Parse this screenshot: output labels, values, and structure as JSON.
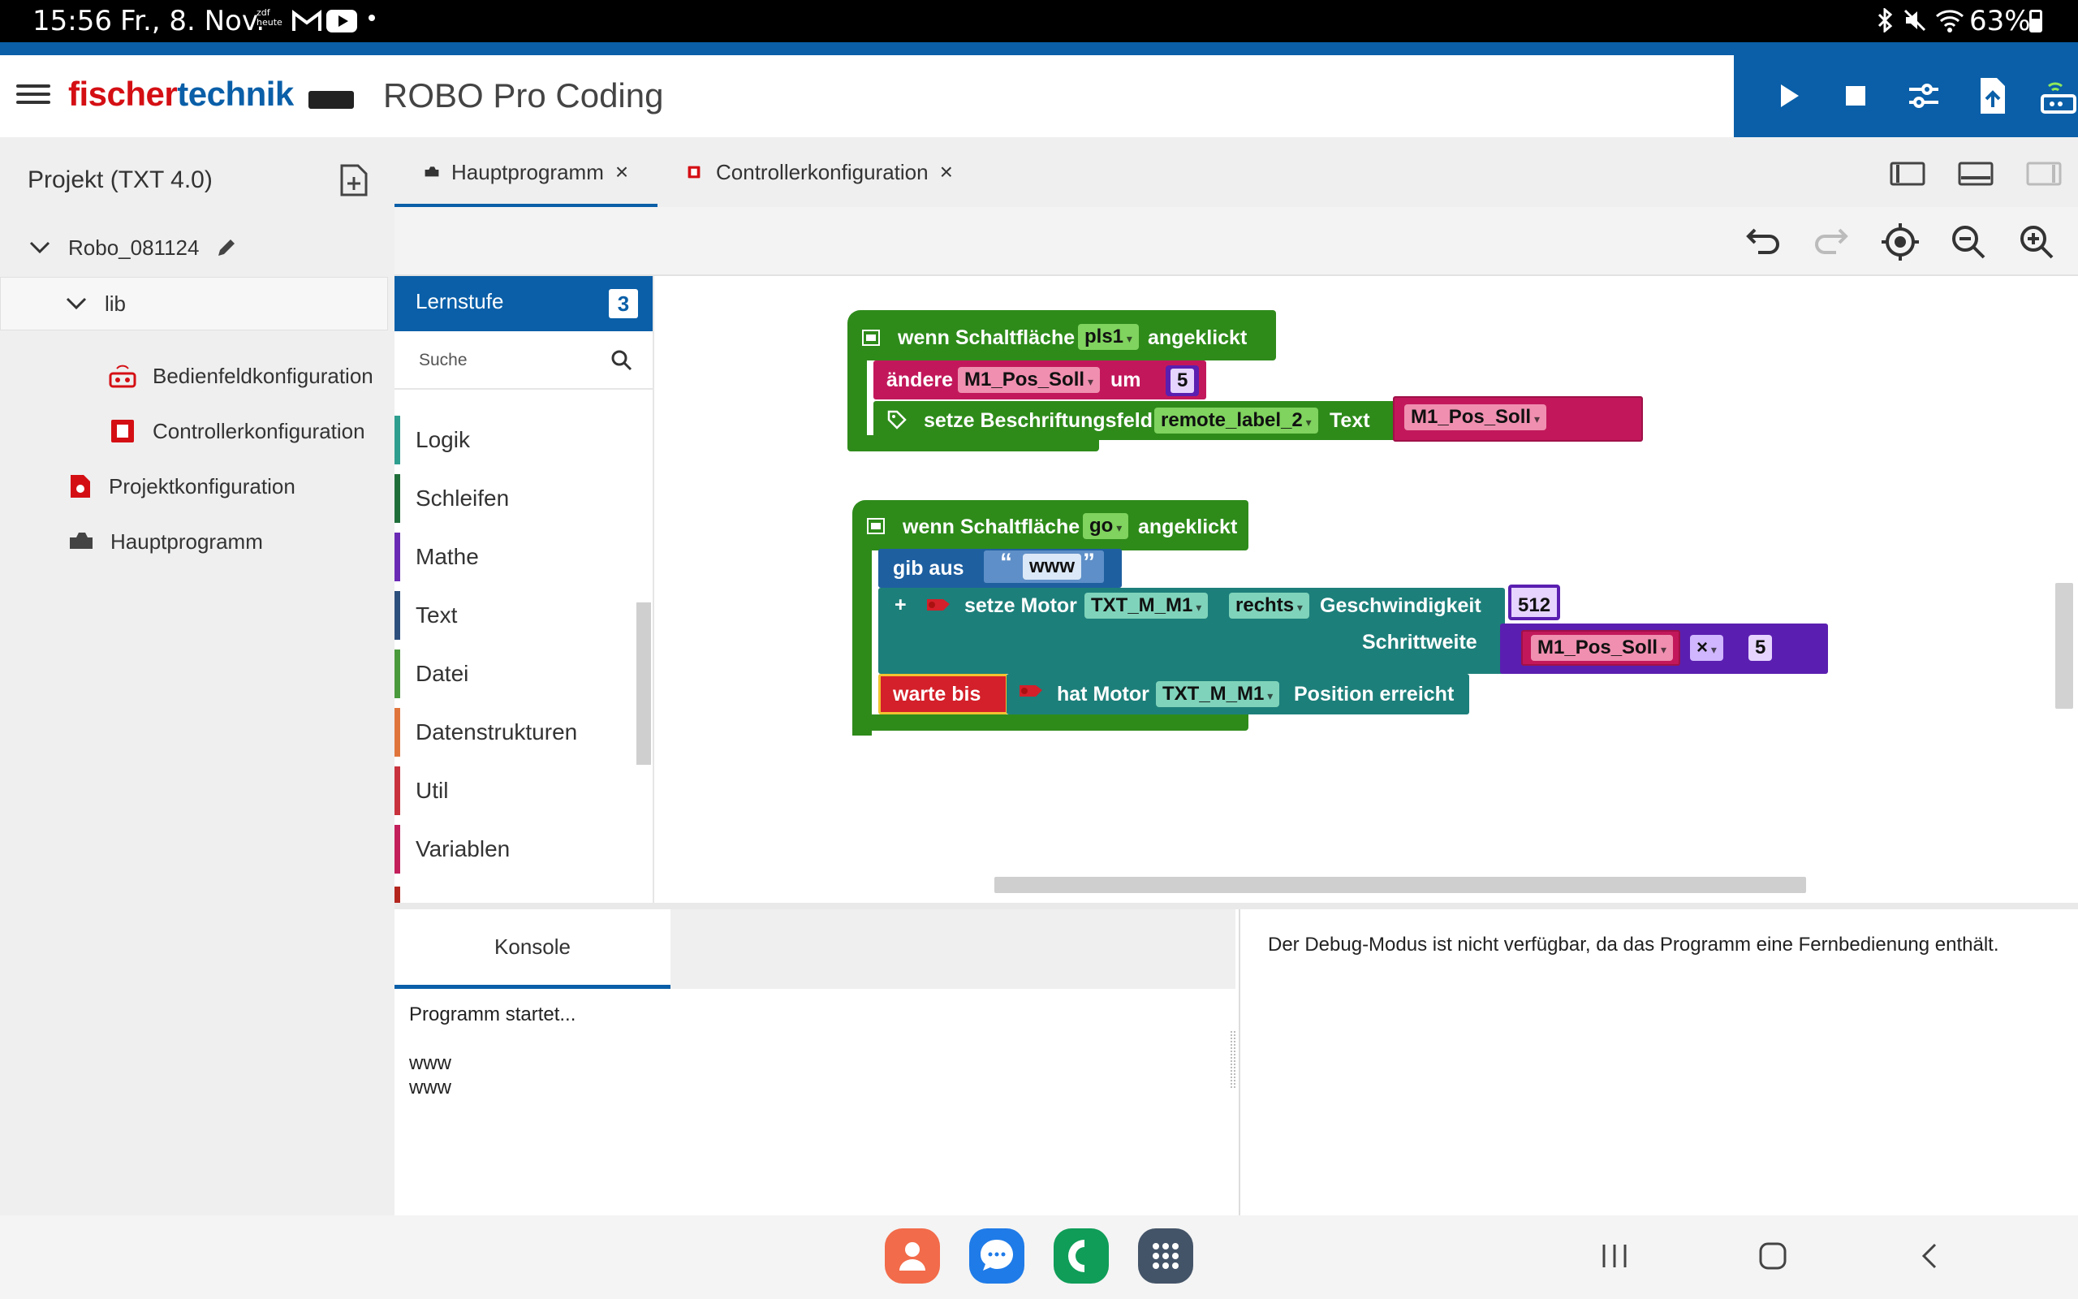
{
  "status_bar": {
    "time": "15:56",
    "date": "Fr., 8. Nov.",
    "notif_zdf": "zdf heute",
    "battery": "63%",
    "icons": [
      "zdf-icon",
      "gmail-icon",
      "youtube-icon",
      "dot-icon",
      "bluetooth-icon",
      "mute-icon",
      "wifi-icon",
      "battery-icon"
    ]
  },
  "header": {
    "brand_red": "fischer",
    "brand_blue": "technik",
    "app_title": "ROBO Pro Coding",
    "toolbar_icons": [
      "play-icon",
      "stop-icon",
      "settings-sliders-icon",
      "upload-icon",
      "controller-connect-icon"
    ]
  },
  "sidebar": {
    "project_title": "Projekt (TXT 4.0)",
    "items": [
      {
        "label": "Robo_081124",
        "icon": "chevron-down-icon"
      },
      {
        "label": "lib",
        "icon": "chevron-down-icon"
      },
      {
        "label": "Bedienfeldkonfiguration",
        "icon": "remote-panel-icon"
      },
      {
        "label": "Controllerkonfiguration",
        "icon": "controller-icon"
      },
      {
        "label": "Projektkonfiguration",
        "icon": "project-config-icon"
      },
      {
        "label": "Hauptprogramm",
        "icon": "program-icon"
      }
    ]
  },
  "tabs": [
    {
      "label": "Hauptprogramm",
      "close": "×",
      "active": true
    },
    {
      "label": "Controllerkonfiguration",
      "close": "×",
      "active": false
    }
  ],
  "toolbox": {
    "lernstufe_label": "Lernstufe",
    "lernstufe_value": "3",
    "search_placeholder": "Suche",
    "categories": [
      {
        "label": "Logik",
        "color": "#2e9e8f"
      },
      {
        "label": "Schleifen",
        "color": "#1f6e3a"
      },
      {
        "label": "Mathe",
        "color": "#6a2ab4"
      },
      {
        "label": "Text",
        "color": "#2d4f7c"
      },
      {
        "label": "Datei",
        "color": "#4a9a3c"
      },
      {
        "label": "Datenstrukturen",
        "color": "#e0753c"
      },
      {
        "label": "Util",
        "color": "#c8323c"
      },
      {
        "label": "Variablen",
        "color": "#c21f5b"
      }
    ]
  },
  "blocks": {
    "event1": {
      "pre": "wenn Schaltfläche",
      "button": "pls1",
      "post": "angeklickt"
    },
    "change": {
      "pre": "ändere",
      "var": "M1_Pos_Soll",
      "mid": "um",
      "value": "5"
    },
    "setlabel": {
      "pre": "setze Beschriftungsfeld",
      "field": "remote_label_2",
      "mid": "Text",
      "var": "M1_Pos_Soll"
    },
    "event2": {
      "pre": "wenn Schaltfläche",
      "button": "go",
      "post": "angeklickt"
    },
    "print": {
      "pre": "gib aus",
      "open_quote": "“",
      "text": "www",
      "close_quote": "”"
    },
    "motor": {
      "plus": "+",
      "pre": "setze Motor",
      "motor": "TXT_M_M1",
      "direction": "rechts",
      "speed_label": "Geschwindigkeit",
      "speed": "512",
      "step_label": "Schrittweite",
      "var": "M1_Pos_Soll",
      "op": "×",
      "factor": "5"
    },
    "wait": {
      "pre": "warte bis",
      "mid": "hat Motor",
      "motor": "TXT_M_M1",
      "post": "Position erreicht"
    },
    "colors": {
      "event": "#2e8b1a",
      "variable": "#c2185b",
      "text": "#1e5fa0",
      "motor": "#1d7f7a",
      "math": "#5a1fb0",
      "wait": "#2e8b1a"
    }
  },
  "console": {
    "tab_label": "Konsole",
    "lines": [
      "Programm startet...",
      "www",
      "www"
    ]
  },
  "debug": {
    "message": "Der Debug-Modus ist nicht verfügbar, da das Programm eine Fernbedienung enthält."
  },
  "nav_bar": {
    "apps": [
      "contacts-icon",
      "messages-icon",
      "phone-icon",
      "apps-grid-icon"
    ],
    "buttons": [
      "recents-icon",
      "home-icon",
      "back-icon"
    ]
  }
}
